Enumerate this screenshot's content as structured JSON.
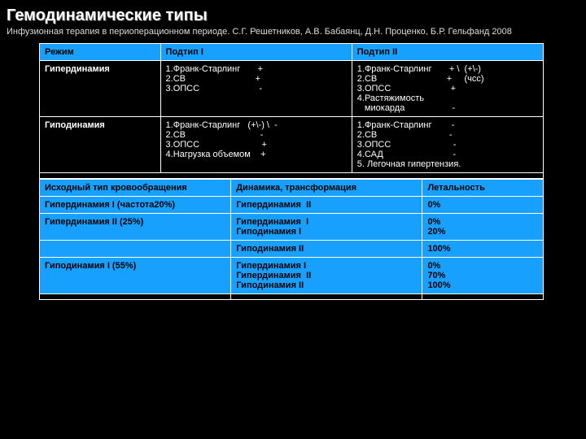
{
  "title": "Гемодинамические типы",
  "subtitle": "Инфузионная терапия в периоперационном периоде. С.Г. Решетников, А.В. Бабаянц, Д.Н. Проценко, Б.Р. Гельфанд 2008",
  "top_table": {
    "header": {
      "c1": "Режим",
      "c2": "Подтип I",
      "c3": "Подтип II"
    },
    "rows": [
      {
        "mode": "Гипердинамия",
        "sub1": "1.Франк-Старлинг       +\n2.СВ                            +\n3.ОПСС                        -",
        "sub2": "1.Франк-Старлинг       + \\  (+\\-)\n2.СВ                            +     (чсс)\n3.ОПСС                        +\n4.Растяжимость\n   миокарда                   -"
      },
      {
        "mode": "Гиподинамия",
        "sub1": "1.Франк-Старлинг   (+\\-) \\  -\n2.СВ                              -\n3.ОПСС                         +\n4.Нагрузка объемом    +",
        "sub2": "1.Франк-Старлинг        -\n2.СВ                             -\n3.ОПСС                         -\n4.САД                            -\n5. Легочная гипертензия."
      }
    ]
  },
  "bottom_table": {
    "header": {
      "c1": "Исходный тип кровообращения",
      "c2": "Динамика, трансформация",
      "c3": "Летальность"
    },
    "rows": [
      {
        "c1": "Гипердинамия I (частота20%)",
        "c2": "Гипердинамия  II",
        "c3": "0%"
      },
      {
        "c1": "Гипердинамия II (25%)",
        "c2": "Гипердинамия  I\nГиподинамия I",
        "c3": "0%\n20%"
      },
      {
        "c1": "",
        "c2": "Гиподинамия II",
        "c3": "100%"
      },
      {
        "c1": "Гиподинамия  I  (55%)",
        "c2": "Гипердинамия I\nГипердинамия  II\nГиподинамия II",
        "c3": "0%\n70%\n100%"
      }
    ]
  }
}
